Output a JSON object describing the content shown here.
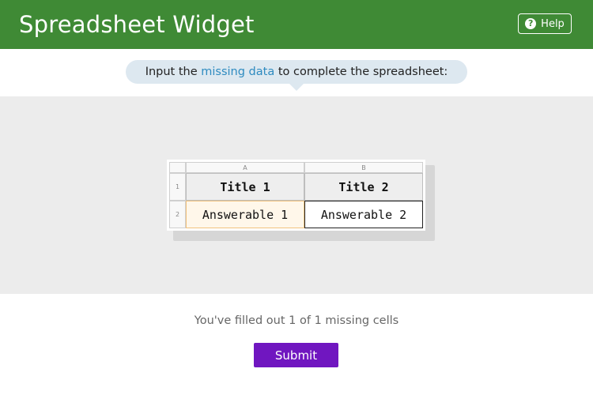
{
  "header": {
    "title": "Spreadsheet Widget",
    "help_label": "Help",
    "help_icon": "question-circle-icon",
    "background": "#3f8a35"
  },
  "prompt": {
    "before": "Input the ",
    "highlight": "missing data",
    "after": " to complete the spreadsheet:",
    "highlight_color": "#2e8bc0"
  },
  "sheet": {
    "columns": [
      "A",
      "B"
    ],
    "rows": [
      "1",
      "2"
    ],
    "cells": [
      [
        "Title 1",
        "Title 2"
      ],
      [
        "Answerable 1",
        "Answerable 2"
      ]
    ]
  },
  "status": {
    "text": "You've filled out 1 of 1 missing cells"
  },
  "submit": {
    "label": "Submit",
    "color": "#7016c0"
  }
}
